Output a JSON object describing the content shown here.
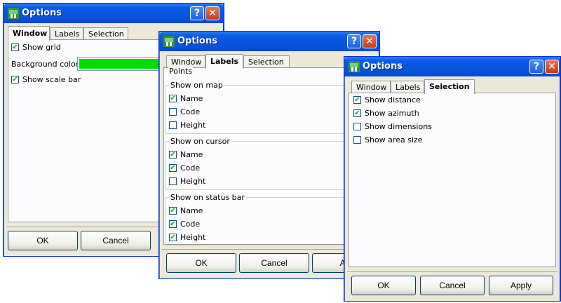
{
  "colors": {
    "background_swatch": "#00dd00"
  },
  "window1": {
    "title": "Options",
    "tabs": [
      "Window",
      "Labels",
      "Selection"
    ],
    "show_grid": "Show grid",
    "background_color_label": "Background color",
    "show_scale_bar": "Show scale bar",
    "ok": "OK",
    "cancel": "Cancel"
  },
  "window2": {
    "title": "Options",
    "tabs": [
      "Window",
      "Labels",
      "Selection"
    ],
    "points": "Points",
    "map_group": "Show on map",
    "cursor_group": "Show on cursor",
    "status_group": "Show on status bar",
    "name": "Name",
    "code": "Code",
    "height": "Height",
    "ok": "OK",
    "cancel": "Cancel",
    "apply_partial": "App"
  },
  "window3": {
    "title": "Options",
    "tabs": [
      "Window",
      "Labels",
      "Selection"
    ],
    "show_distance": "Show distance",
    "show_azimuth": "Show azimuth",
    "show_dimensions": "Show dimensions",
    "show_area_size": "Show area size",
    "ok": "OK",
    "cancel": "Cancel",
    "apply": "Apply"
  },
  "checkmark": "✔",
  "help_glyph": "?",
  "close_glyph": "✕"
}
